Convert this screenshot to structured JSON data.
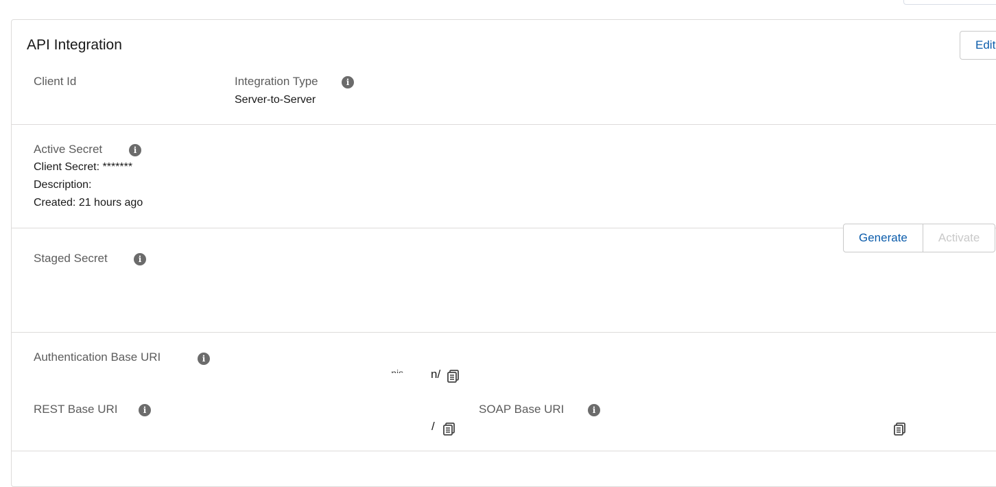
{
  "card": {
    "title": "API Integration",
    "edit_label": "Edit"
  },
  "client_id": {
    "label": "Client Id"
  },
  "integration_type": {
    "label": "Integration Type",
    "value": "Server-to-Server"
  },
  "active_secret": {
    "label": "Active Secret",
    "client_secret": "Client Secret: *******",
    "description": "Description:",
    "created": "Created: 21 hours ago"
  },
  "staged_secret": {
    "label": "Staged Secret",
    "generate_label": "Generate",
    "activate_label": "Activate"
  },
  "auth_base_uri": {
    "label": "Authentication Base URI",
    "value_fragment_a": "· ·nis",
    "value_fragment_b": "n/"
  },
  "rest_base_uri": {
    "label": "REST Base URI",
    "value_fragment": "/"
  },
  "soap_base_uri": {
    "label": "SOAP Base URI"
  },
  "icons": {
    "info": "info-icon",
    "copy": "copy-icon"
  },
  "colors": {
    "link": "#0b5cab",
    "icon": "#6b6b6b",
    "border": "#dddbda"
  }
}
